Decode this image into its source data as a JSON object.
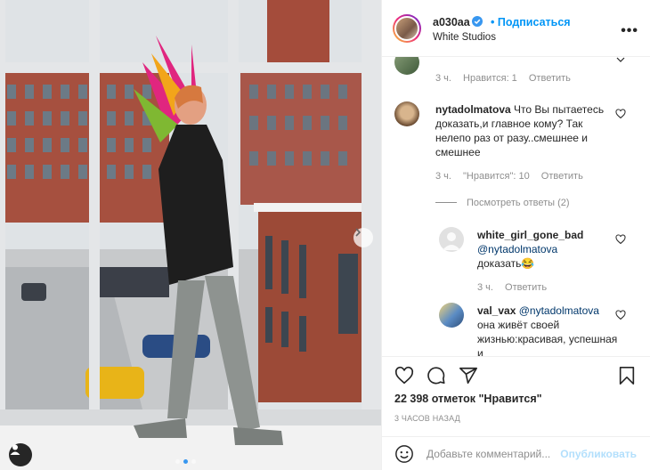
{
  "post": {
    "username": "a030aa",
    "follow_label": "Подписаться",
    "location": "White Studios",
    "more_icon": "more-horizontal-icon"
  },
  "comments": [
    {
      "username": "",
      "text": "",
      "time": "3 ч.",
      "likes": "Нравится: 1",
      "reply": "Ответить"
    },
    {
      "username": "nytadolmatova",
      "text": "Что Вы пытаетесь доказать,и главное кому? Так нелепо раз от разу..смешнее и смешнее",
      "time": "3 ч.",
      "likes": "\"Нравится\": 10",
      "reply": "Ответить",
      "view_replies": "Посмотреть ответы (2)"
    },
    {
      "username": "white_girl_gone_bad",
      "mention": "@nytadolmatova",
      "text": "доказать😂",
      "time": "3 ч.",
      "reply": "Ответить"
    },
    {
      "username": "val_vax",
      "mention": "@nytadolmatova",
      "text": "она живёт своей жизнью:красивая, успешная и"
    }
  ],
  "actions": {
    "likes": "22 398 отметок \"Нравится\"",
    "time_ago": "3 ЧАСОВ НАЗАД"
  },
  "add_comment": {
    "placeholder": "Добавьте комментарий...",
    "publish_label": "Опубликовать"
  },
  "colors": {
    "accent": "#0095f6",
    "publish_disabled": "#b2dffc",
    "meta": "#8e8e8e"
  },
  "carousel": {
    "total_slides": 3,
    "active_slide": 2
  }
}
